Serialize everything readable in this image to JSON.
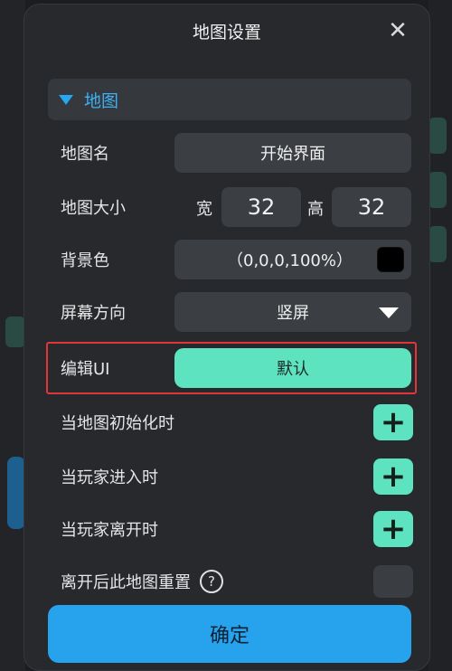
{
  "dialog": {
    "title": "地图设置",
    "close_icon": "close-icon"
  },
  "section": {
    "label": "地图"
  },
  "map_name": {
    "label": "地图名",
    "value": "开始界面"
  },
  "map_size": {
    "label": "地图大小",
    "width_label": "宽",
    "width_value": "32",
    "height_label": "高",
    "height_value": "32"
  },
  "background_color": {
    "label": "背景色",
    "value": "（0,0,0,100%）",
    "swatch_color": "#000000"
  },
  "screen_orientation": {
    "label": "屏幕方向",
    "value": "竖屏"
  },
  "edit_ui": {
    "label": "编辑UI",
    "value": "默认"
  },
  "events": [
    {
      "label": "当地图初始化时"
    },
    {
      "label": "当玩家进入时"
    },
    {
      "label": "当玩家离开时"
    }
  ],
  "reset_option": {
    "label": "离开后此地图重置",
    "help": "?"
  },
  "plus_symbol": "+",
  "confirm_label": "确定",
  "colors": {
    "accent_blue": "#27a3ee",
    "accent_green": "#5de3bf",
    "highlight_red": "#e0353a"
  }
}
